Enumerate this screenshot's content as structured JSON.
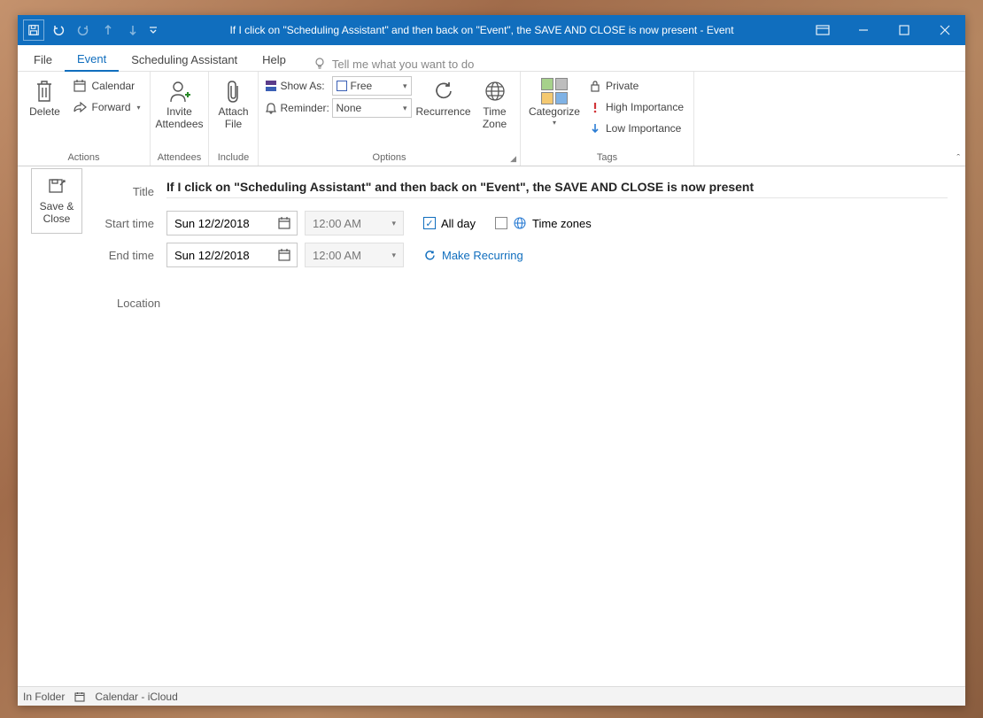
{
  "title": "If I click on \"Scheduling Assistant\" and then back on \"Event\", the SAVE AND CLOSE is now present  -  Event",
  "tabs": {
    "file": "File",
    "event": "Event",
    "scheduling": "Scheduling Assistant",
    "help": "Help",
    "tellme": "Tell me what you want to do"
  },
  "ribbon": {
    "actions": {
      "label": "Actions",
      "delete": "Delete",
      "calendar": "Calendar",
      "forward": "Forward"
    },
    "attendees": {
      "label": "Attendees",
      "invite1": "Invite",
      "invite2": "Attendees"
    },
    "include": {
      "label": "Include",
      "attach1": "Attach",
      "attach2": "File"
    },
    "options": {
      "label": "Options",
      "showas": "Show As:",
      "showas_val": "Free",
      "reminder": "Reminder:",
      "reminder_val": "None",
      "recurrence": "Recurrence",
      "tz1": "Time",
      "tz2": "Zone"
    },
    "tags": {
      "label": "Tags",
      "categorize": "Categorize",
      "private": "Private",
      "high": "High Importance",
      "low": "Low Importance"
    }
  },
  "saveclose1": "Save &",
  "saveclose2": "Close",
  "form": {
    "title_label": "Title",
    "title_value": "If I click on \"Scheduling Assistant\" and then back on \"Event\", the SAVE AND CLOSE is now present",
    "start_label": "Start time",
    "end_label": "End time",
    "start_date": "Sun 12/2/2018",
    "end_date": "Sun 12/2/2018",
    "start_time": "12:00 AM",
    "end_time": "12:00 AM",
    "allday": "All day",
    "timezones": "Time zones",
    "make_recurring": "Make Recurring",
    "location_label": "Location"
  },
  "status": {
    "infolder": "In Folder",
    "calendar": "Calendar - iCloud"
  }
}
